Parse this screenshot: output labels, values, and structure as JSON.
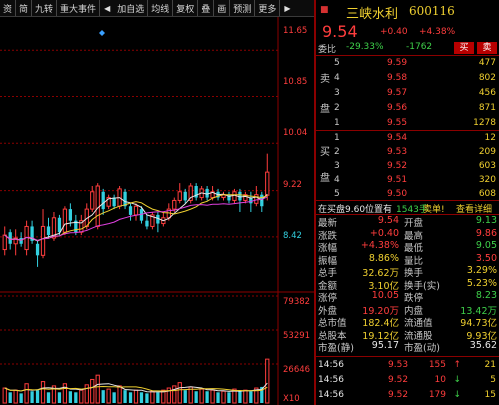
{
  "toolbar": {
    "items": [
      "资",
      "简",
      "九转",
      "重大事件",
      "加自选",
      "均线",
      "复权",
      "叠",
      "画",
      "预测",
      "更多"
    ],
    "prev_arrow": "◀",
    "next_arrow": "▶"
  },
  "chart": {
    "price_axis": [
      "11.65",
      "10.85",
      "10.04",
      "9.22",
      "8.42"
    ],
    "volume_axis": [
      "79382",
      "53291",
      "26646",
      "X10"
    ],
    "candles": [
      {
        "o": 8.2,
        "c": 8.45,
        "h": 8.6,
        "l": 8.1,
        "up": true
      },
      {
        "o": 8.5,
        "c": 8.3,
        "h": 8.55,
        "l": 8.2,
        "up": false
      },
      {
        "o": 8.3,
        "c": 8.4,
        "h": 8.55,
        "l": 8.1,
        "up": true
      },
      {
        "o": 8.4,
        "c": 8.3,
        "h": 8.5,
        "l": 8.25,
        "up": false
      },
      {
        "o": 8.2,
        "c": 8.6,
        "h": 8.7,
        "l": 8.1,
        "up": true
      },
      {
        "o": 8.6,
        "c": 8.35,
        "h": 8.7,
        "l": 8.3,
        "up": false
      },
      {
        "o": 8.3,
        "c": 8.1,
        "h": 8.35,
        "l": 7.9,
        "up": false
      },
      {
        "o": 8.1,
        "c": 8.6,
        "h": 8.9,
        "l": 8.05,
        "up": true
      },
      {
        "o": 8.6,
        "c": 8.45,
        "h": 8.75,
        "l": 8.4,
        "up": false
      },
      {
        "o": 8.4,
        "c": 8.75,
        "h": 8.85,
        "l": 8.35,
        "up": true
      },
      {
        "o": 8.75,
        "c": 8.5,
        "h": 8.8,
        "l": 8.45,
        "up": false
      },
      {
        "o": 8.5,
        "c": 8.9,
        "h": 8.95,
        "l": 8.45,
        "up": true
      },
      {
        "o": 8.9,
        "c": 8.7,
        "h": 9.0,
        "l": 8.6,
        "up": false
      },
      {
        "o": 8.7,
        "c": 8.5,
        "h": 8.8,
        "l": 8.45,
        "up": false
      },
      {
        "o": 8.5,
        "c": 8.7,
        "h": 8.8,
        "l": 8.45,
        "up": true
      },
      {
        "o": 8.6,
        "c": 8.9,
        "h": 9.0,
        "l": 8.55,
        "up": true
      },
      {
        "o": 8.9,
        "c": 9.2,
        "h": 9.3,
        "l": 8.85,
        "up": true
      },
      {
        "o": 8.6,
        "c": 9.3,
        "h": 9.35,
        "l": 8.55,
        "up": true
      },
      {
        "o": 9.2,
        "c": 8.9,
        "h": 9.25,
        "l": 8.8,
        "up": false
      },
      {
        "o": 8.95,
        "c": 9.1,
        "h": 9.15,
        "l": 8.9,
        "up": true
      },
      {
        "o": 9.1,
        "c": 8.95,
        "h": 9.15,
        "l": 8.9,
        "up": false
      },
      {
        "o": 8.95,
        "c": 9.25,
        "h": 9.3,
        "l": 8.9,
        "up": true
      },
      {
        "o": 9.2,
        "c": 8.95,
        "h": 9.25,
        "l": 8.9,
        "up": false
      },
      {
        "o": 8.95,
        "c": 8.8,
        "h": 9.0,
        "l": 8.7,
        "up": false
      },
      {
        "o": 8.8,
        "c": 8.95,
        "h": 9.0,
        "l": 8.7,
        "up": true
      },
      {
        "o": 8.9,
        "c": 8.7,
        "h": 8.95,
        "l": 8.65,
        "up": false
      },
      {
        "o": 8.7,
        "c": 8.6,
        "h": 8.8,
        "l": 8.55,
        "up": false
      },
      {
        "o": 8.6,
        "c": 8.8,
        "h": 8.85,
        "l": 8.55,
        "up": true
      },
      {
        "o": 8.8,
        "c": 8.65,
        "h": 8.85,
        "l": 8.5,
        "up": false
      },
      {
        "o": 8.65,
        "c": 8.75,
        "h": 8.85,
        "l": 8.6,
        "up": true
      },
      {
        "o": 8.75,
        "c": 8.9,
        "h": 9.0,
        "l": 8.7,
        "up": true
      },
      {
        "o": 8.9,
        "c": 9.05,
        "h": 9.1,
        "l": 8.85,
        "up": true
      },
      {
        "o": 9.05,
        "c": 9.2,
        "h": 9.35,
        "l": 9.0,
        "up": true
      },
      {
        "o": 9.2,
        "c": 9.05,
        "h": 9.25,
        "l": 9.0,
        "up": false
      },
      {
        "o": 9.05,
        "c": 9.3,
        "h": 9.35,
        "l": 9.0,
        "up": true
      },
      {
        "o": 9.3,
        "c": 9.1,
        "h": 9.35,
        "l": 9.05,
        "up": false
      },
      {
        "o": 9.1,
        "c": 9.25,
        "h": 9.3,
        "l": 9.05,
        "up": true
      },
      {
        "o": 9.25,
        "c": 9.1,
        "h": 9.3,
        "l": 9.05,
        "up": false
      },
      {
        "o": 9.1,
        "c": 9.2,
        "h": 9.3,
        "l": 9.05,
        "up": true
      },
      {
        "o": 9.2,
        "c": 9.1,
        "h": 9.25,
        "l": 9.05,
        "up": false
      },
      {
        "o": 9.1,
        "c": 9.15,
        "h": 9.2,
        "l": 9.05,
        "up": true
      },
      {
        "o": 9.15,
        "c": 9.05,
        "h": 9.2,
        "l": 9.0,
        "up": false
      },
      {
        "o": 9.05,
        "c": 9.2,
        "h": 9.25,
        "l": 9.0,
        "up": true
      },
      {
        "o": 9.2,
        "c": 9.05,
        "h": 9.25,
        "l": 8.85,
        "up": false
      },
      {
        "o": 9.05,
        "c": 9.15,
        "h": 9.2,
        "l": 9.0,
        "up": true
      },
      {
        "o": 9.1,
        "c": 9.0,
        "h": 9.2,
        "l": 8.85,
        "up": false
      },
      {
        "o": 9.0,
        "c": 9.15,
        "h": 9.3,
        "l": 8.95,
        "up": true
      },
      {
        "o": 9.15,
        "c": 8.95,
        "h": 9.2,
        "l": 8.85,
        "up": false
      },
      {
        "o": 9.14,
        "c": 9.54,
        "h": 9.86,
        "l": 9.05,
        "up": true
      }
    ],
    "volumes": [
      0.14,
      0.1,
      0.12,
      0.09,
      0.18,
      0.11,
      0.12,
      0.2,
      0.1,
      0.16,
      0.1,
      0.18,
      0.11,
      0.1,
      0.12,
      0.17,
      0.22,
      0.26,
      0.12,
      0.13,
      0.1,
      0.16,
      0.12,
      0.1,
      0.12,
      0.1,
      0.09,
      0.11,
      0.1,
      0.12,
      0.14,
      0.16,
      0.19,
      0.12,
      0.15,
      0.11,
      0.13,
      0.11,
      0.12,
      0.1,
      0.11,
      0.1,
      0.13,
      0.11,
      0.12,
      0.11,
      0.14,
      0.15,
      0.41
    ]
  },
  "quote": {
    "name": "三峡水利",
    "code": "600116",
    "price": "9.54",
    "change": "+0.40",
    "change_pct": "+4.38%",
    "webi_label": "委比",
    "webi_value": "-29.33%",
    "webi_diff": "-1762",
    "buy_btn": "买",
    "sell_btn": "卖",
    "sell_side_label": [
      "卖",
      "盘"
    ],
    "buy_side_label": [
      "买",
      "盘"
    ],
    "asks": [
      {
        "lvl": "5",
        "price": "9.59",
        "vol": "477"
      },
      {
        "lvl": "4",
        "price": "9.58",
        "vol": "802"
      },
      {
        "lvl": "3",
        "price": "9.57",
        "vol": "456"
      },
      {
        "lvl": "2",
        "price": "9.56",
        "vol": "871"
      },
      {
        "lvl": "1",
        "price": "9.55",
        "vol": "1278"
      }
    ],
    "bids": [
      {
        "lvl": "1",
        "price": "9.54",
        "vol": "12"
      },
      {
        "lvl": "2",
        "price": "9.53",
        "vol": "209"
      },
      {
        "lvl": "3",
        "price": "9.52",
        "vol": "603"
      },
      {
        "lvl": "4",
        "price": "9.51",
        "vol": "320"
      },
      {
        "lvl": "5",
        "price": "9.50",
        "vol": "608"
      }
    ],
    "ticker_text": "在买盘9.60位置有",
    "ticker_vol": "1543手",
    "ticker_action": "卖单!",
    "ticker_link": "查看详细",
    "stats": [
      {
        "l1": "最新",
        "v1": "9.54",
        "c1": "red",
        "l2": "开盘",
        "v2": "9.13",
        "c2": "grn"
      },
      {
        "l1": "涨跌",
        "v1": "+0.40",
        "c1": "red",
        "l2": "最高",
        "v2": "9.86",
        "c2": "red"
      },
      {
        "l1": "涨幅",
        "v1": "+4.38%",
        "c1": "red",
        "l2": "最低",
        "v2": "9.05",
        "c2": "grn"
      },
      {
        "l1": "振幅",
        "v1": "8.86%",
        "c1": "yel",
        "l2": "量比",
        "v2": "3.50",
        "c2": "red"
      },
      {
        "l1": "总手",
        "v1": "32.62万",
        "c1": "yel",
        "l2": "换手",
        "v2": "3.29%",
        "c2": "yel"
      },
      {
        "l1": "金额",
        "v1": "3.10亿",
        "c1": "yel",
        "l2": "换手(实)",
        "v2": "5.23%",
        "c2": "yel"
      },
      {
        "l1": "涨停",
        "v1": "10.05",
        "c1": "red",
        "l2": "跌停",
        "v2": "8.23",
        "c2": "grn"
      },
      {
        "l1": "外盘",
        "v1": "19.20万",
        "c1": "red",
        "l2": "内盘",
        "v2": "13.42万",
        "c2": "grn"
      },
      {
        "l1": "总市值",
        "v1": "182.4亿",
        "c1": "yel",
        "l2": "流通值",
        "v2": "94.73亿",
        "c2": "yel"
      },
      {
        "l1": "总股本",
        "v1": "19.12亿",
        "c1": "yel",
        "l2": "流通股",
        "v2": "9.93亿",
        "c2": "yel"
      },
      {
        "l1": "市盈(静)",
        "v1": "95.17",
        "c1": "wht",
        "l2": "市盈(动)",
        "v2": "35.62",
        "c2": "wht"
      }
    ],
    "ticks": [
      {
        "time": "14:56",
        "price": "9.53",
        "vol": "155",
        "dir": "↑",
        "dc": "red",
        "cnt": "21"
      },
      {
        "time": "14:56",
        "price": "9.52",
        "vol": "10",
        "dir": "↓",
        "dc": "grn",
        "cnt": "5"
      },
      {
        "time": "14:56",
        "price": "9.52",
        "vol": "179",
        "dir": "↓",
        "dc": "grn",
        "cnt": "15"
      }
    ]
  },
  "colors": {
    "up": "#ff3d3d",
    "down": "#33d0e0",
    "grid": "#8b0000",
    "ma5": "#e8e8e8",
    "ma10": "#f0d030",
    "ma20": "#e040e0"
  }
}
